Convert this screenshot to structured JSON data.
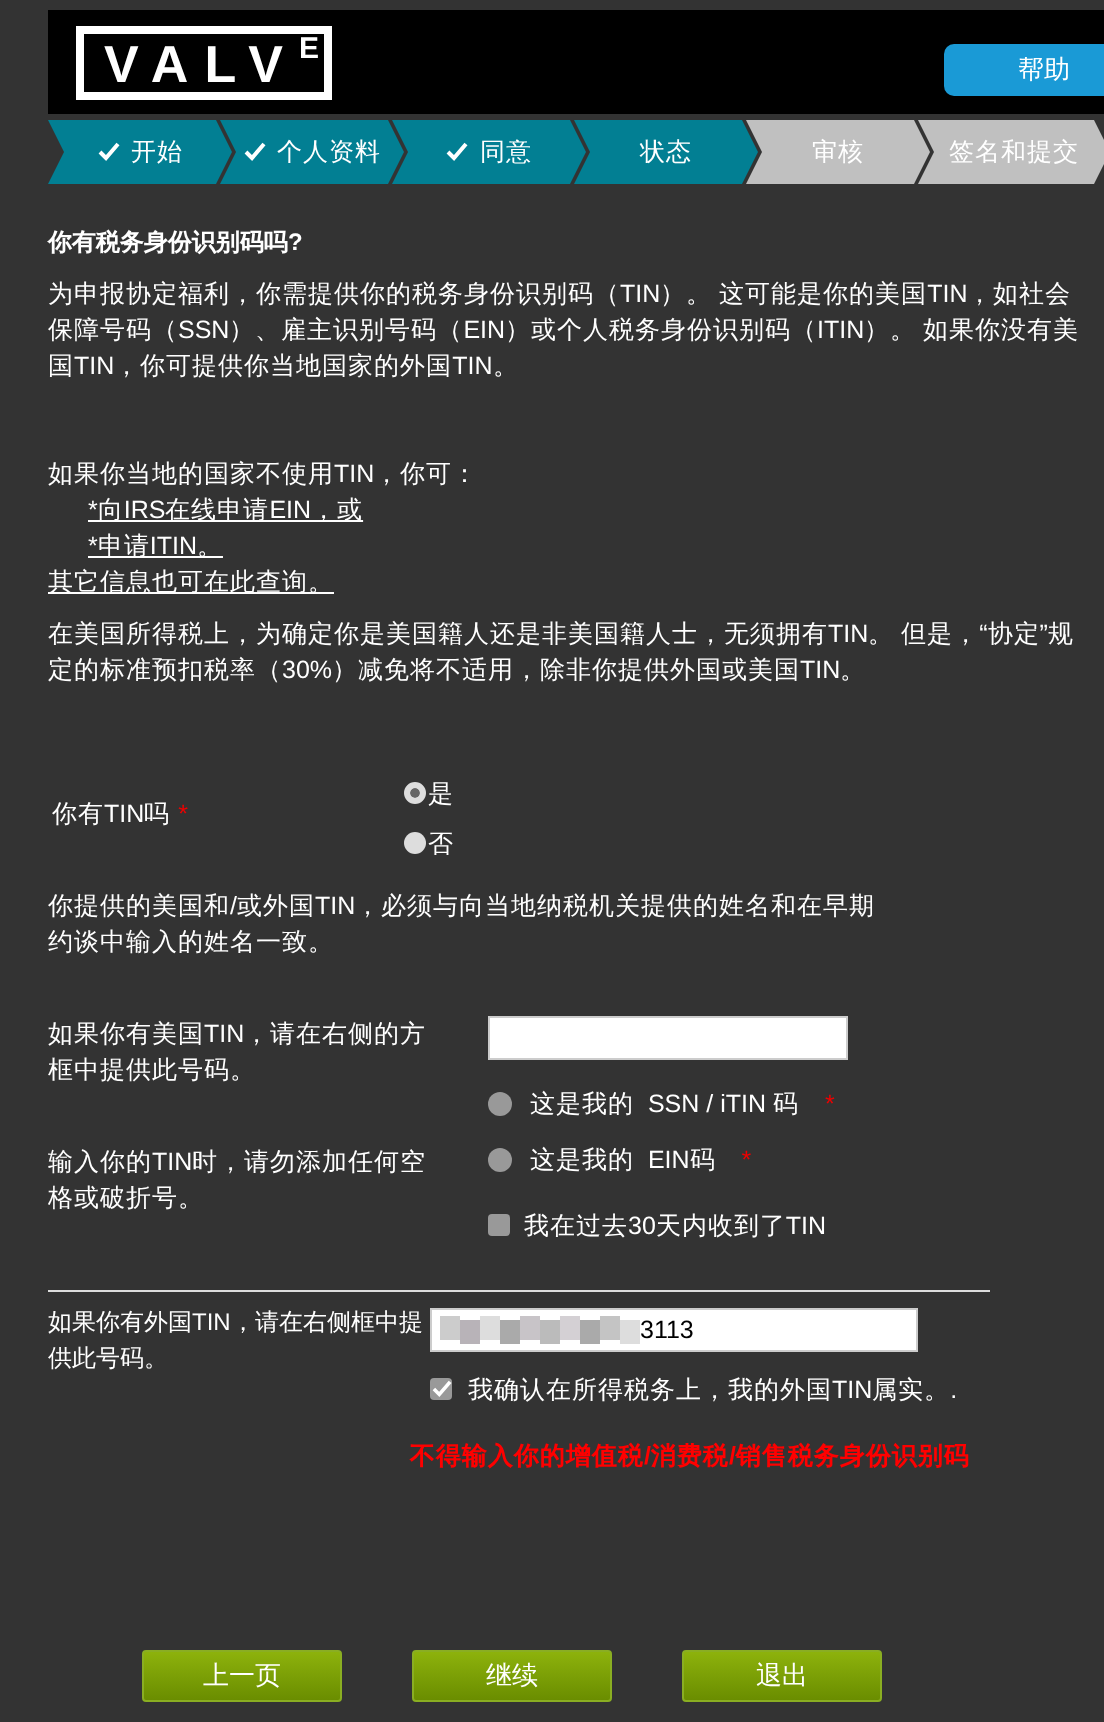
{
  "header": {
    "logo": "VALV$^{E}$",
    "help_button": "帮助"
  },
  "steps": [
    {
      "label": "开始",
      "done": true,
      "reached": true
    },
    {
      "label": "个人资料",
      "done": true,
      "reached": true
    },
    {
      "label": "同意",
      "done": true,
      "reached": true
    },
    {
      "label": "状态",
      "done": false,
      "reached": true
    },
    {
      "label": "审核",
      "done": false,
      "reached": false
    },
    {
      "label": "签名和提交",
      "done": false,
      "reached": false
    }
  ],
  "title": "你有税务身份识别码吗?",
  "intro": "为申报协定福利，你需提供你的税务身份识别码（TIN）。 这可能是你的美国TIN，如社会保障号码（SSN）、雇主识别号码（EIN）或个人税务身份识别码（ITIN）。 如果你没有美国TIN，你可提供你当地国家的外国TIN。",
  "no_tin_intro": "如果你当地的国家不使用TIN，你可：",
  "links": [
    "*向IRS在线申请EIN，或",
    "*申请ITIN。"
  ],
  "more_info_link": "其它信息也可在此查询。",
  "note": "在美国所得税上，为确定你是美国籍人还是非美国籍人士，无须拥有TIN。 但是，“协定”规定的标准预扣税率（30%）减免将不适用，除非你提供外国或美国TIN。",
  "has_tin": {
    "label": "你有TIN吗",
    "required_mark": "*",
    "options": [
      {
        "label": "是",
        "selected": true
      },
      {
        "label": "否",
        "selected": false
      }
    ]
  },
  "match_note": "你提供的美国和/或外国TIN，必须与向当地纳税机关提供的姓名和在早期约谈中输入的姓名一致。",
  "us_tin": {
    "label": "如果你有美国TIN，请在右侧的方框中提供此号码。",
    "hint": "输入你的TIN时，请勿添加任何空格或破折号。",
    "types": [
      {
        "label": "这是我的  SSN / iTIN 码",
        "required_mark": "*",
        "selected": false
      },
      {
        "label": "这是我的  EIN码",
        "required_mark": "*",
        "selected": false
      }
    ],
    "recent": {
      "label": "我在过去30天内收到了TIN",
      "checked": false
    }
  },
  "foreign_tin": {
    "label": "如果你有外国TIN，请在右侧框中提供此号码。",
    "value": "3113",
    "redacted": true,
    "confirm": {
      "label": "我确认在所得税务上，我的外国TIN属实。.",
      "checked": true
    },
    "warning": "不得输入你的增值税/消费税/销售税务身份识别码"
  },
  "buttons": [
    "上一页",
    "继续",
    "退出"
  ]
}
